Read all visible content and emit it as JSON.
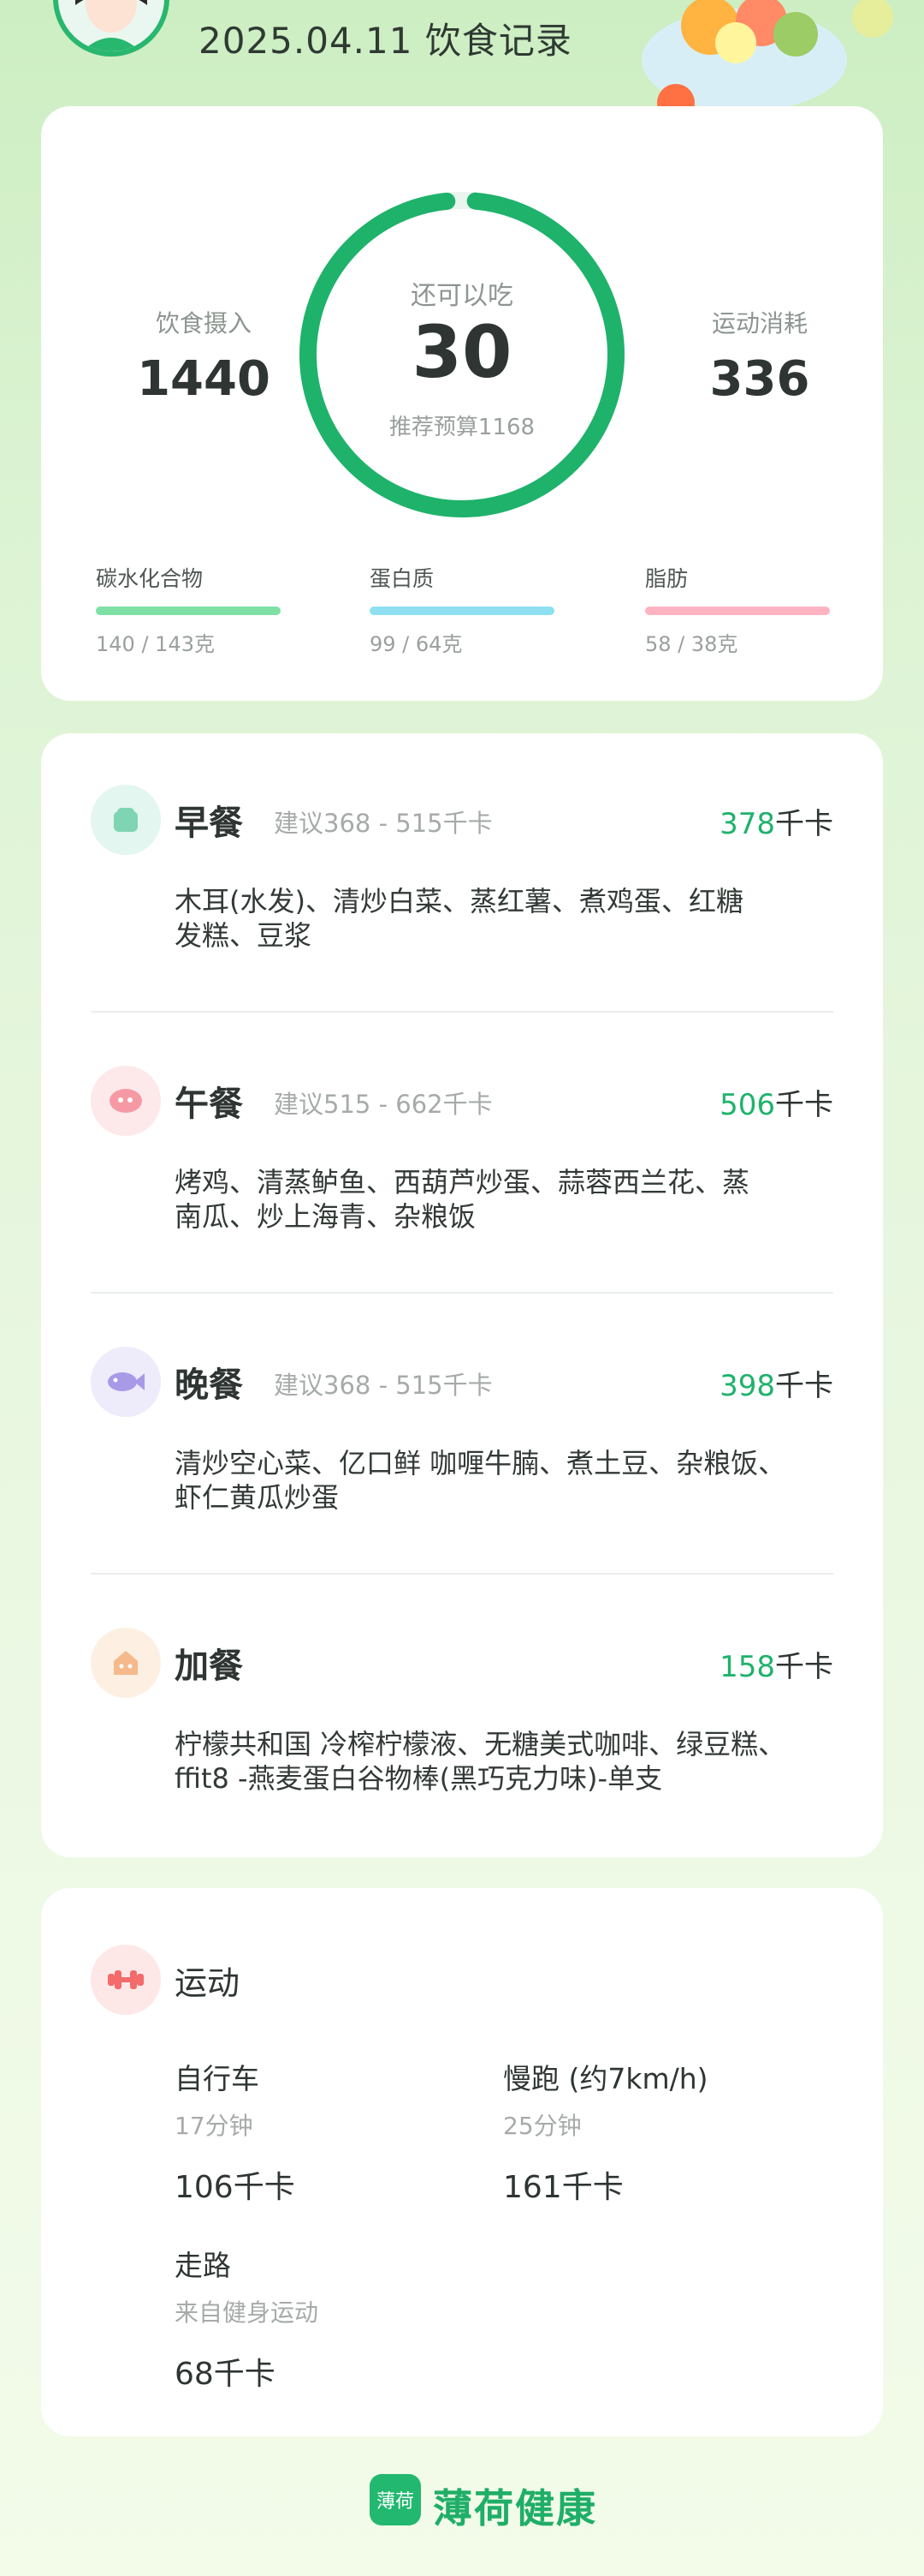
{
  "header": {
    "title": "2025.04.11 饮食记录"
  },
  "summary": {
    "intake_label": "饮食摄入",
    "intake_value": "1440",
    "remaining_label": "还可以吃",
    "remaining_value": "30",
    "budget_text": "推荐预算1168",
    "burned_label": "运动消耗",
    "burned_value": "336",
    "ring_progress": 0.97,
    "colors": {
      "ring": "#1fb26b",
      "carbs": "#7fe0a6",
      "protein": "#8ee0f0",
      "fat": "#ffb3c1"
    },
    "macros": [
      {
        "label": "碳水化合物",
        "value": "140 / 143克",
        "ratio": 0.98
      },
      {
        "label": "蛋白质",
        "value": "99 / 64克",
        "ratio": 1.0
      },
      {
        "label": "脂肪",
        "value": "58 / 38克",
        "ratio": 1.0
      }
    ]
  },
  "meals": [
    {
      "name": "早餐",
      "suggest": "建议368 - 515千卡",
      "cal_num": "378",
      "cal_unit": "千卡",
      "foods_line1": "木耳(水发)、清炒白菜、蒸红薯、煮鸡蛋、红糖",
      "foods_line2": "发糕、豆浆",
      "icon": "toast-icon"
    },
    {
      "name": "午餐",
      "suggest": "建议515 - 662千卡",
      "cal_num": "506",
      "cal_unit": "千卡",
      "foods_line1": "烤鸡、清蒸鲈鱼、西葫芦炒蛋、蒜蓉西兰花、蒸",
      "foods_line2": "南瓜、炒上海青、杂粮饭",
      "icon": "meat-icon"
    },
    {
      "name": "晚餐",
      "suggest": "建议368 - 515千卡",
      "cal_num": "398",
      "cal_unit": "千卡",
      "foods_line1": "清炒空心菜、亿口鲜 咖喱牛腩、煮土豆、杂粮饭、",
      "foods_line2": "虾仁黄瓜炒蛋",
      "icon": "fish-icon"
    },
    {
      "name": "加餐",
      "suggest": "",
      "cal_num": "158",
      "cal_unit": "千卡",
      "foods_line1": "柠檬共和国 冷榨柠檬液、无糖美式咖啡、绿豆糕、",
      "foods_line2": "ffit8 -燕麦蛋白谷物棒(黑巧克力味)-单支",
      "icon": "snack-icon"
    }
  ],
  "exercise": {
    "title": "运动",
    "items": [
      {
        "name": "自行车",
        "sub": "17分钟",
        "cal": "106千卡"
      },
      {
        "name": "慢跑 (约7km/h)",
        "sub": "25分钟",
        "cal": "161千卡"
      },
      {
        "name": "走路",
        "sub": "来自健身运动",
        "cal": "68千卡"
      }
    ]
  },
  "footer": {
    "logo_text": "薄荷",
    "brand": "薄荷健康"
  }
}
